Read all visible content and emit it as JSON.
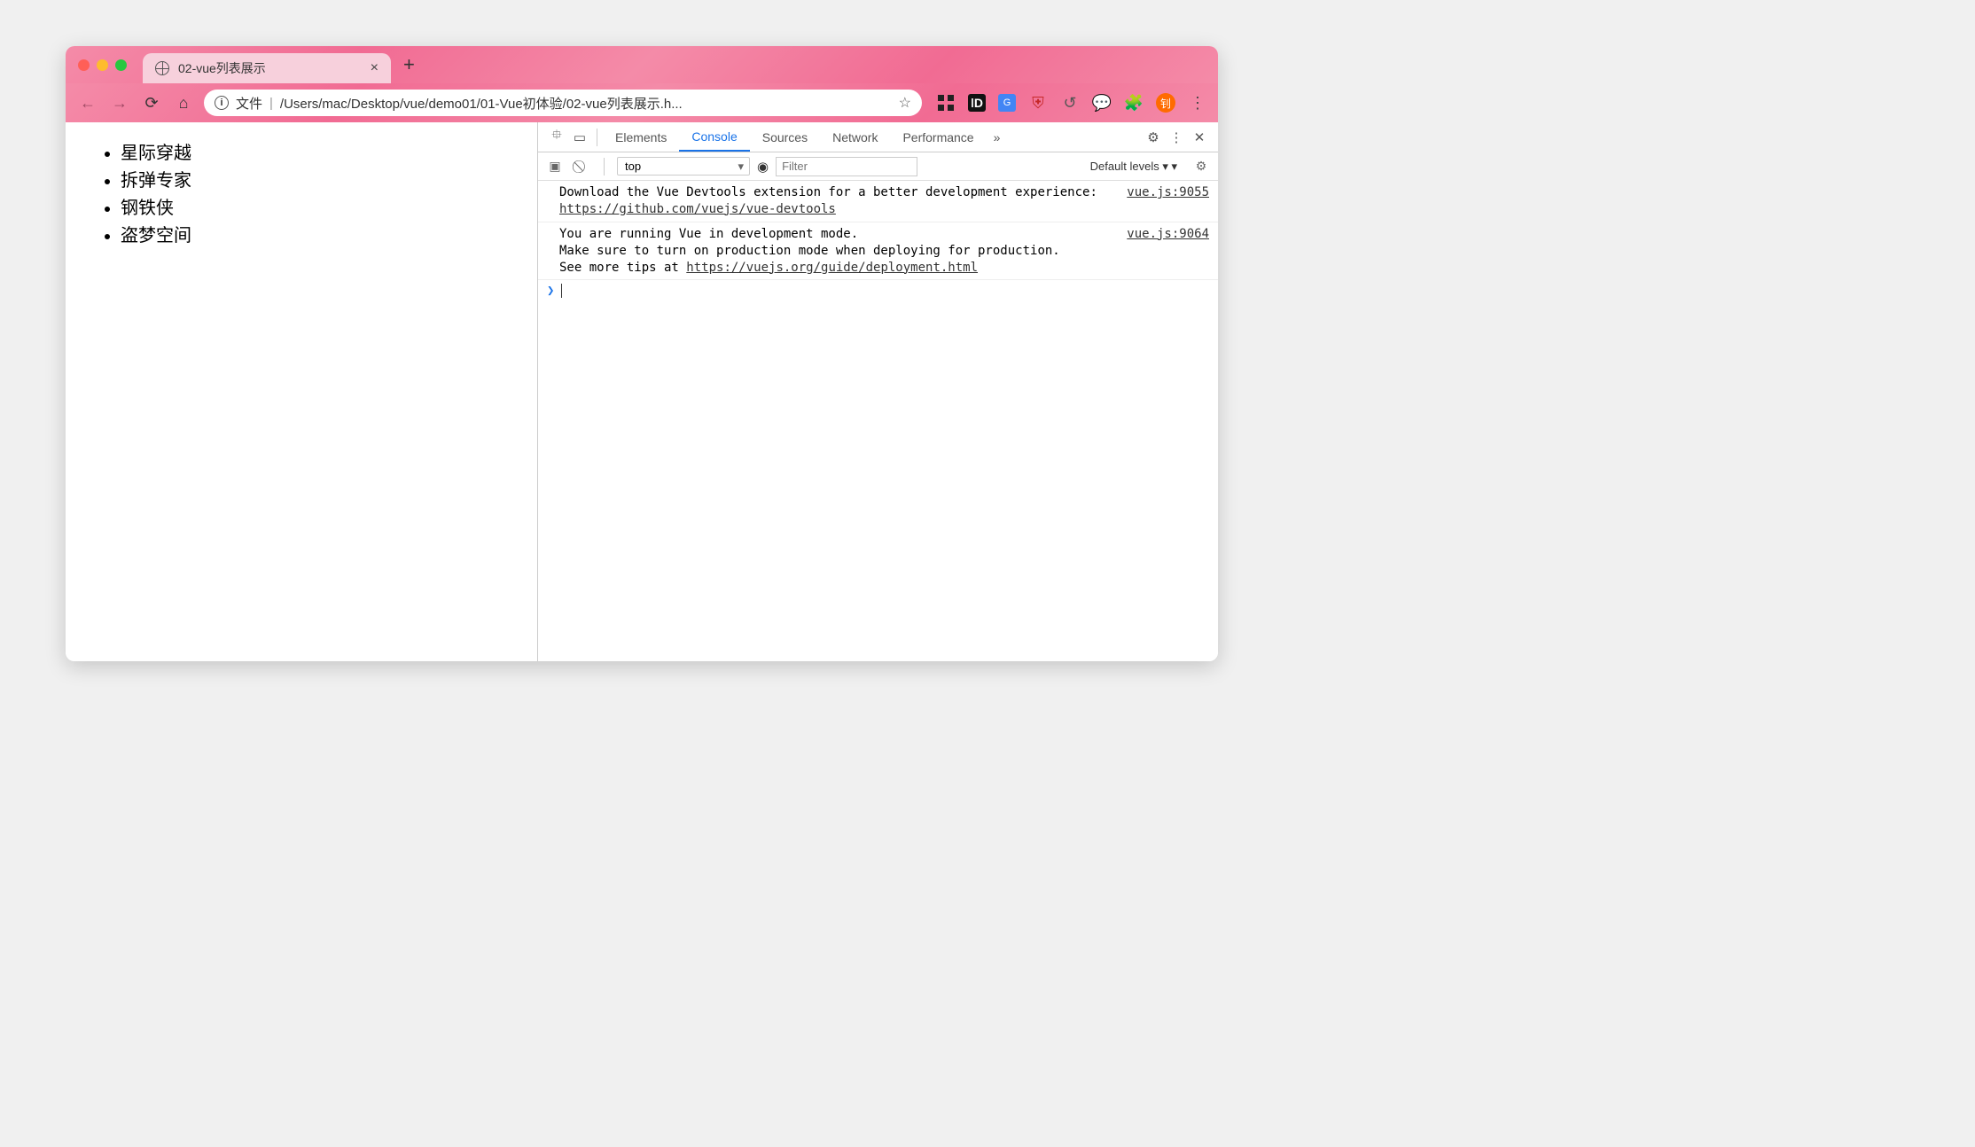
{
  "tab": {
    "title": "02-vue列表展示"
  },
  "addr": {
    "label": "文件",
    "path": "/Users/mac/Desktop/vue/demo01/01-Vue初体验/02-vue列表展示.h..."
  },
  "avatar_letter": "钊",
  "page_list": [
    "星际穿越",
    "拆弹专家",
    "钢铁侠",
    "盗梦空间"
  ],
  "devtools": {
    "tabs": [
      "Elements",
      "Console",
      "Sources",
      "Network",
      "Performance"
    ],
    "active_tab": "Console",
    "context": "top",
    "filter_placeholder": "Filter",
    "levels_label": "Default levels",
    "messages": [
      {
        "text": "Download the Vue Devtools extension for a better development experience:",
        "link": "https://github.com/vuejs/vue-devtools",
        "source": "vue.js:9055"
      },
      {
        "text": "You are running Vue in development mode.\nMake sure to turn on production mode when deploying for production.\nSee more tips at ",
        "link": "https://vuejs.org/guide/deployment.html",
        "source": "vue.js:9064"
      }
    ]
  }
}
